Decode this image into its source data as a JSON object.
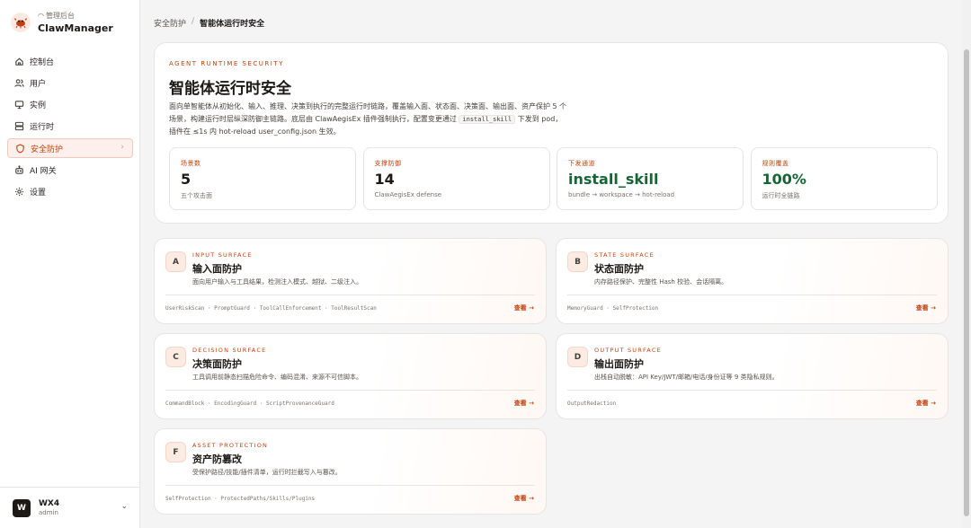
{
  "brand": {
    "sub": "管理后台",
    "name": "ClawManager"
  },
  "nav": [
    {
      "label": "控制台",
      "icon": "home-icon"
    },
    {
      "label": "用户",
      "icon": "users-icon"
    },
    {
      "label": "实例",
      "icon": "monitor-icon"
    },
    {
      "label": "运行时",
      "icon": "server-icon"
    },
    {
      "label": "安全防护",
      "icon": "shield-icon",
      "active": true
    },
    {
      "label": "AI 网关",
      "icon": "bot-icon"
    },
    {
      "label": "设置",
      "icon": "gear-icon"
    }
  ],
  "user": {
    "avatar": "W",
    "name": "WX4",
    "role": "admin"
  },
  "breadcrumb": {
    "parent": "安全防护",
    "sep": "/",
    "current": "智能体运行时安全"
  },
  "hero": {
    "eyebrow": "AGENT RUNTIME SECURITY",
    "title": "智能体运行时安全",
    "desc_a": "面向单智能体从初始化、输入、推理、决策到执行的完整运行时链路，覆盖输入面、状态面、决策面、输出面、资产保护 5 个场景，构建运行时层纵深防御主链路。底层由 ClawAegisEx 插件强制执行，配置变更通过 ",
    "desc_code": "install_skill",
    "desc_b": " 下发到 pod，插件在 ≤1s 内 hot-reload user_config.json 生效。"
  },
  "stats": [
    {
      "label": "场景数",
      "value": "5",
      "sub": "五个攻击面"
    },
    {
      "label": "支撑防御",
      "value": "14",
      "sub": "ClawAegisEx defense"
    },
    {
      "label": "下发通道",
      "value": "install_skill",
      "sub": "bundle → workspace → hot-reload"
    },
    {
      "label": "规则覆盖",
      "value": "100%",
      "sub": "运行时全链路"
    }
  ],
  "cards": [
    {
      "letter": "A",
      "eyebrow": "INPUT SURFACE",
      "title": "输入面防护",
      "desc": "面向用户输入与工具结果，检测注入模式、越狱、二级注入。",
      "tags": "UserRiskScan · PromptGuard · ToolCallEnforcement · ToolResultScan",
      "link": "查看 →"
    },
    {
      "letter": "B",
      "eyebrow": "STATE SURFACE",
      "title": "状态面防护",
      "desc": "内存路径保护、完整性 Hash 校验、会话隔离。",
      "tags": "MemoryGuard · SelfProtection",
      "link": "查看 →"
    },
    {
      "letter": "C",
      "eyebrow": "DECISION SURFACE",
      "title": "决策面防护",
      "desc": "工具调用前静态扫描危险命令、编码混淆、来源不可信脚本。",
      "tags": "CommandBlock · EncodingGuard · ScriptProvenanceGuard",
      "link": "查看 →"
    },
    {
      "letter": "D",
      "eyebrow": "OUTPUT SURFACE",
      "title": "输出面防护",
      "desc": "出栈自动脱敏：API Key/JWT/邮箱/电话/身份证等 9 类隐私规则。",
      "tags": "OutputRedaction",
      "link": "查看 →"
    },
    {
      "letter": "F",
      "eyebrow": "ASSET PROTECTION",
      "title": "资产防篡改",
      "desc": "受保护路径/技能/插件清单，运行时拦截写入与篡改。",
      "tags": "SelfProtection · ProtectedPaths/Skills/Plugins",
      "link": "查看 →"
    }
  ],
  "colors": {
    "accent": "#c2410c",
    "accent_bg": "#fdf0ec",
    "green": "#166534"
  }
}
